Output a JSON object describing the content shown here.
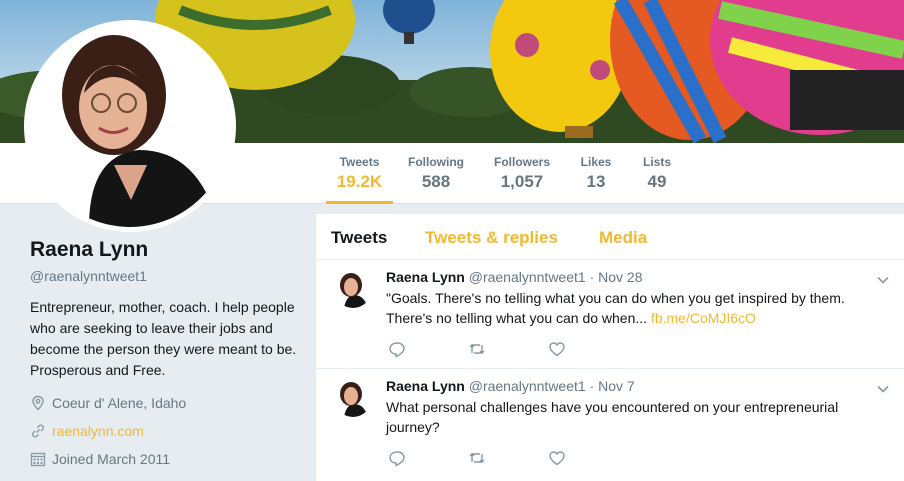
{
  "profile": {
    "name": "Raena Lynn",
    "handle": "@raenalynntweet1",
    "bio": "Entrepreneur, mother, coach. I help people who are seeking to leave their jobs and become the person they were meant to be. Prosperous and Free.",
    "location": "Coeur d' Alene, Idaho",
    "website": "raenalynn.com",
    "joined": "Joined March 2011"
  },
  "stats": [
    {
      "label": "Tweets",
      "value": "19.2K"
    },
    {
      "label": "Following",
      "value": "588"
    },
    {
      "label": "Followers",
      "value": "1,057"
    },
    {
      "label": "Likes",
      "value": "13"
    },
    {
      "label": "Lists",
      "value": "49"
    }
  ],
  "tabs": [
    "Tweets",
    "Tweets & replies",
    "Media"
  ],
  "tweets": [
    {
      "name": "Raena Lynn",
      "handle": "@raenalynntweet1",
      "date": "· Nov 28",
      "text": "\"Goals. There's no telling what you can do when you get inspired by them. There's no telling what you can do when...",
      "link": "fb.me/CoMJI6cO"
    },
    {
      "name": "Raena Lynn",
      "handle": "@raenalynntweet1",
      "date": "· Nov 7",
      "text": "What personal challenges have you encountered on your entrepreneurial journey?",
      "link": ""
    }
  ],
  "colors": {
    "accent": "#f2b830",
    "muted": "#657786",
    "background": "#e6ecf0"
  },
  "icons": {
    "location": "map-pin-icon",
    "website": "link-icon",
    "joined": "calendar-icon",
    "reply": "reply-icon",
    "retweet": "retweet-icon",
    "like": "heart-icon",
    "menu": "chevron-down-icon"
  }
}
